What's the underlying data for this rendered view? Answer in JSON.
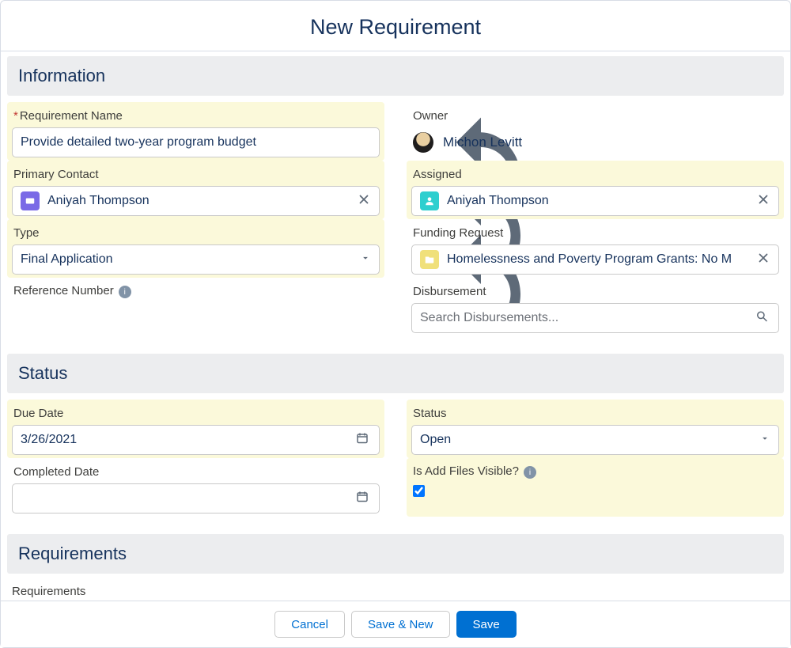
{
  "title": "New Requirement",
  "sections": {
    "information": "Information",
    "status": "Status",
    "requirements": "Requirements"
  },
  "info": {
    "requirement_name_label": "Requirement Name",
    "requirement_name_value": "Provide detailed two-year program budget",
    "owner_label": "Owner",
    "owner_name": "Michon Levitt",
    "primary_contact_label": "Primary Contact",
    "primary_contact_value": "Aniyah Thompson",
    "assigned_label": "Assigned",
    "assigned_value": "Aniyah Thompson",
    "type_label": "Type",
    "type_value": "Final Application",
    "funding_request_label": "Funding Request",
    "funding_request_value": "Homelessness and Poverty Program Grants: No M",
    "reference_number_label": "Reference Number",
    "disbursement_label": "Disbursement",
    "disbursement_placeholder": "Search Disbursements..."
  },
  "status": {
    "due_date_label": "Due Date",
    "due_date_value": "3/26/2021",
    "status_label": "Status",
    "status_value": "Open",
    "completed_date_label": "Completed Date",
    "completed_date_value": "",
    "add_files_label": "Is Add Files Visible?",
    "add_files_checked": true
  },
  "requirements": {
    "requirements_label": "Requirements",
    "rte_font": "Salesforce Sans",
    "rte_size": "12"
  },
  "buttons": {
    "cancel": "Cancel",
    "save_new": "Save & New",
    "save": "Save"
  }
}
